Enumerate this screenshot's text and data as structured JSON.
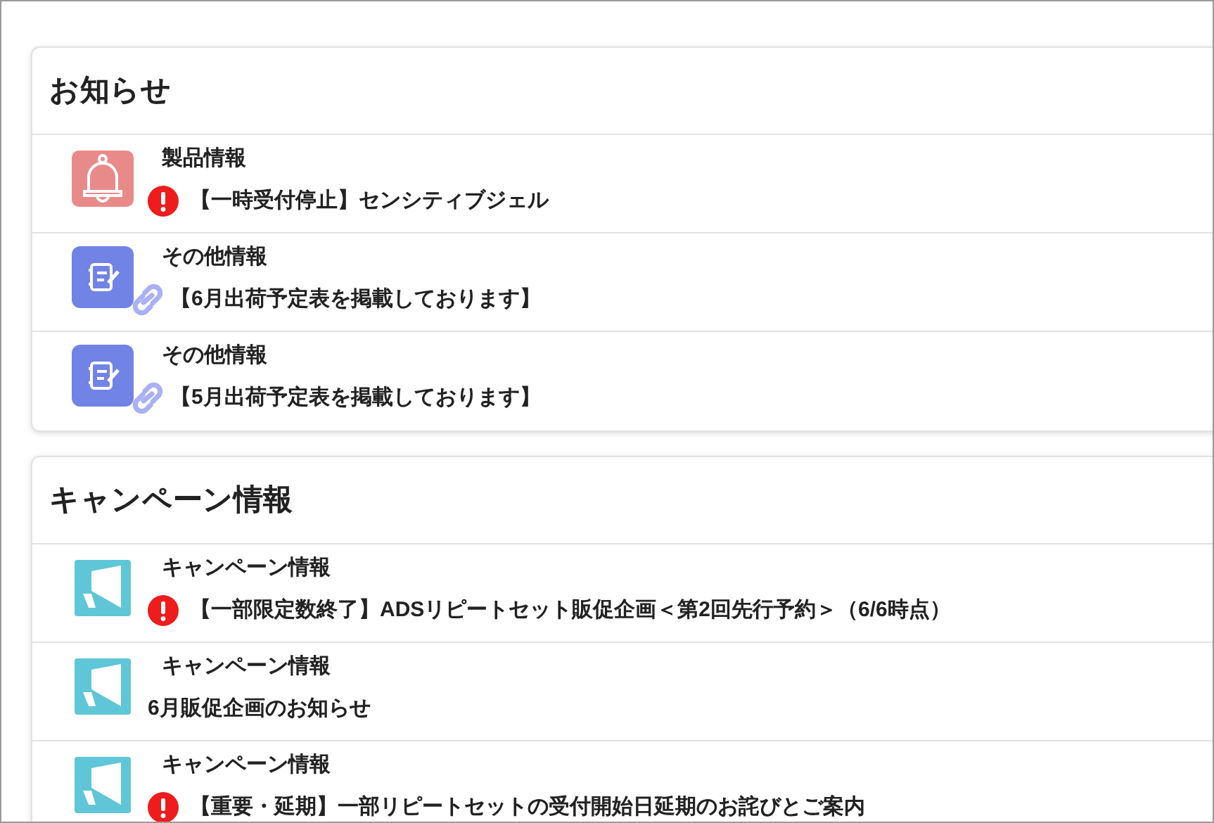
{
  "sections": [
    {
      "title": "お知らせ",
      "items": [
        {
          "kind": "bell",
          "category": "製品情報",
          "important": true,
          "linked": false,
          "text": "【一時受付停止】センシティブジェル"
        },
        {
          "kind": "note",
          "category": "その他情報",
          "important": false,
          "linked": true,
          "text": "【6月出荷予定表を掲載しております】"
        },
        {
          "kind": "note",
          "category": "その他情報",
          "important": false,
          "linked": true,
          "text": "【5月出荷予定表を掲載しております】"
        }
      ]
    },
    {
      "title": "キャンペーン情報",
      "items": [
        {
          "kind": "megaphone",
          "category": "キャンペーン情報",
          "important": true,
          "linked": false,
          "text": "【一部限定数終了】ADSリピートセット販促企画＜第2回先行予約＞（6/6時点）"
        },
        {
          "kind": "megaphone",
          "category": "キャンペーン情報",
          "important": false,
          "linked": false,
          "text": "6月販促企画のお知らせ"
        },
        {
          "kind": "megaphone",
          "category": "キャンペーン情報",
          "important": true,
          "linked": false,
          "text": "【重要・延期】一部リピートセットの受付開始日延期のお詫びとご案内"
        }
      ]
    }
  ]
}
